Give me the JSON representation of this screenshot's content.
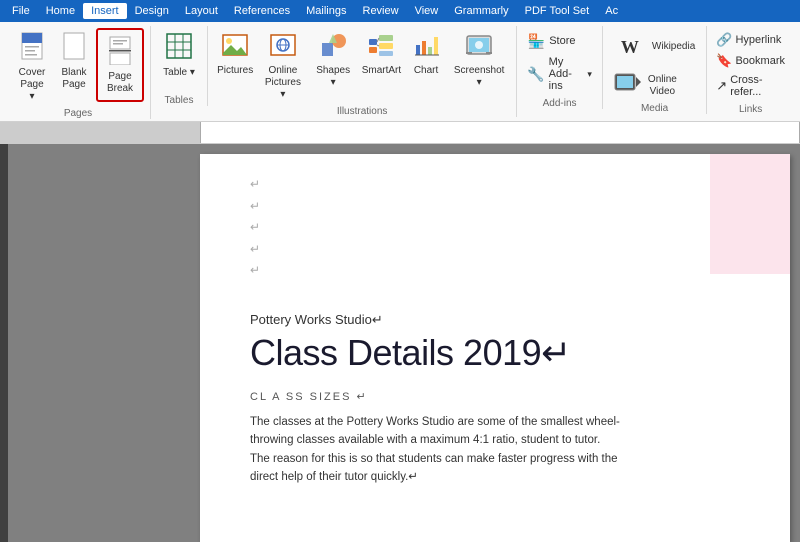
{
  "menubar": {
    "items": [
      "File",
      "Home",
      "Insert",
      "Design",
      "Layout",
      "References",
      "Mailings",
      "Review",
      "View",
      "Grammarly",
      "PDF Tool Set",
      "Ac"
    ]
  },
  "ribbon": {
    "active_tab": "Insert",
    "groups": {
      "pages": {
        "label": "Pages",
        "buttons": [
          {
            "id": "cover-page",
            "label": "Cover\nPage",
            "icon": "🗋",
            "has_arrow": true
          },
          {
            "id": "blank-page",
            "label": "Blank\nPage",
            "icon": "📄"
          },
          {
            "id": "page-break",
            "label": "Page\nBreak",
            "icon": "⊟",
            "highlighted": true
          }
        ]
      },
      "tables": {
        "label": "Tables",
        "buttons": [
          {
            "id": "table",
            "label": "Table",
            "icon": "⊞",
            "has_arrow": true
          }
        ]
      },
      "illustrations": {
        "label": "Illustrations",
        "buttons": [
          {
            "id": "pictures",
            "label": "Pictures",
            "icon": "🖼"
          },
          {
            "id": "online-pictures",
            "label": "Online\nPictures",
            "icon": "🌐"
          },
          {
            "id": "shapes",
            "label": "Shapes",
            "icon": "⬡"
          },
          {
            "id": "smartart",
            "label": "SmartArt",
            "icon": "📊"
          },
          {
            "id": "chart",
            "label": "Chart",
            "icon": "📈"
          },
          {
            "id": "screenshot",
            "label": "Screenshot",
            "icon": "📷"
          }
        ]
      },
      "addins": {
        "label": "Add-ins",
        "items": [
          {
            "id": "store",
            "label": "Store",
            "icon": "🏪"
          },
          {
            "id": "my-addins",
            "label": "My Add-ins",
            "icon": "🔧"
          }
        ]
      },
      "media": {
        "label": "Media",
        "items": [
          {
            "id": "wikipedia",
            "label": "Wikipedia",
            "icon": "W"
          },
          {
            "id": "online-video",
            "label": "Online\nVideo",
            "icon": "▶"
          }
        ]
      },
      "links": {
        "label": "Links",
        "items": [
          {
            "id": "hyperlink",
            "label": "Hyperlink",
            "icon": "🔗"
          },
          {
            "id": "bookmark",
            "label": "Bookmark",
            "icon": "🔖"
          },
          {
            "id": "cross-reference",
            "label": "Cross-refer...",
            "icon": "↗"
          }
        ]
      }
    }
  },
  "document": {
    "return_marks": [
      "↵",
      "↵",
      "↵",
      "↵",
      "↵"
    ],
    "subtitle": "Pottery Works Studio↵",
    "title": "Class Details 2019↵",
    "section_label": "CL A SS SIZES ↵",
    "body_text": "The classes at the Pottery Works Studio are some of the smallest wheel-throwing classes available with a maximum 4:1 ratio, student to tutor. The reason for this is so that students can make faster progress with the direct help of their tutor quickly.↵"
  }
}
